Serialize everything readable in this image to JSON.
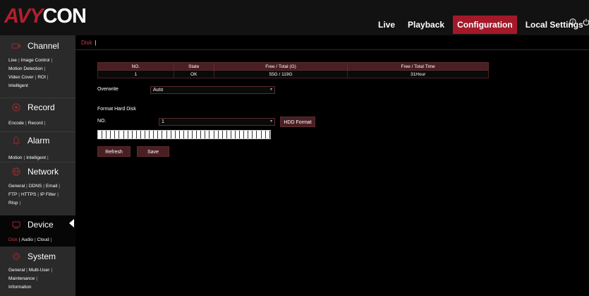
{
  "brand": {
    "logo_accent": "AVY",
    "logo_rest": "CON",
    "accent_color": "#a3192a"
  },
  "nav": [
    {
      "label": "Live",
      "active": false
    },
    {
      "label": "Playback",
      "active": false
    },
    {
      "label": "Configuration",
      "active": true
    },
    {
      "label": "Local Settings",
      "active": false
    }
  ],
  "top_icons": [
    "info-icon",
    "power-icon"
  ],
  "sidebar": {
    "channel": {
      "title": "Channel",
      "links": [
        "Live",
        "Image Control",
        "Motion Detection",
        "Video Cover",
        "ROI",
        "Intelligent"
      ]
    },
    "record": {
      "title": "Record",
      "links": [
        "Encode",
        "Record"
      ]
    },
    "alarm": {
      "title": "Alarm",
      "links": [
        "Motion",
        "Intelligent"
      ]
    },
    "network": {
      "title": "Network",
      "links": [
        "General",
        "DDNS",
        "Email",
        "FTP",
        "HTTPS",
        "IP Filter",
        "Rtsp"
      ]
    },
    "device": {
      "title": "Device",
      "links": [
        "Disk",
        "Audio",
        "Cloud"
      ],
      "active_link": "Disk"
    },
    "system": {
      "title": "System",
      "links": [
        "General",
        "Multi-User",
        "Maintenance",
        "Information"
      ]
    }
  },
  "tabs": [
    {
      "label": "Disk",
      "active": true
    }
  ],
  "disk_table": {
    "headers": [
      "NO.",
      "State",
      "Free / Total (G)",
      "Free / Total Time"
    ],
    "rows": [
      [
        "1",
        "OK",
        "55G / 119G",
        "31Hour"
      ]
    ]
  },
  "overwrite": {
    "label": "Overwrite",
    "value": "Auto"
  },
  "format": {
    "section_label": "Format Hard Disk",
    "no_label": "NO.",
    "no_value": "1",
    "button": "HDD Format"
  },
  "buttons": {
    "refresh": "Refresh",
    "save": "Save"
  }
}
